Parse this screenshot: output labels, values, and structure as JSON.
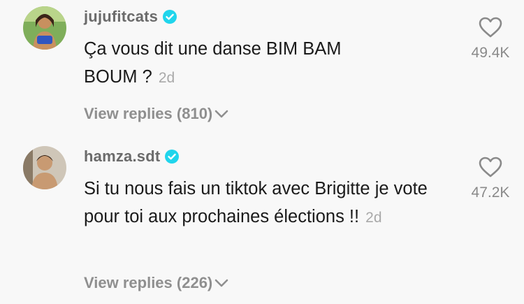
{
  "comments": [
    {
      "username": "jujufitcats",
      "text": "Ça vous dit une danse BIM BAM BOUM ?",
      "time": "2d",
      "replies_label": "View replies (810)",
      "likes": "49.4K",
      "avatar_icon": "profile-photo-avatar",
      "verified": true
    },
    {
      "username": "hamza.sdt",
      "text": "Si tu nous fais un tiktok avec Brigitte je vote pour toi aux prochaines élections !!",
      "time": "2d",
      "replies_label": "View replies (226)",
      "likes": "47.2K",
      "avatar_icon": "profile-photo-avatar",
      "verified": true
    }
  ],
  "colors": {
    "background": "#f8f8f8",
    "verified_badge": "#20d5ec",
    "username": "#6b6b6b",
    "meta": "#a9a9a9"
  }
}
